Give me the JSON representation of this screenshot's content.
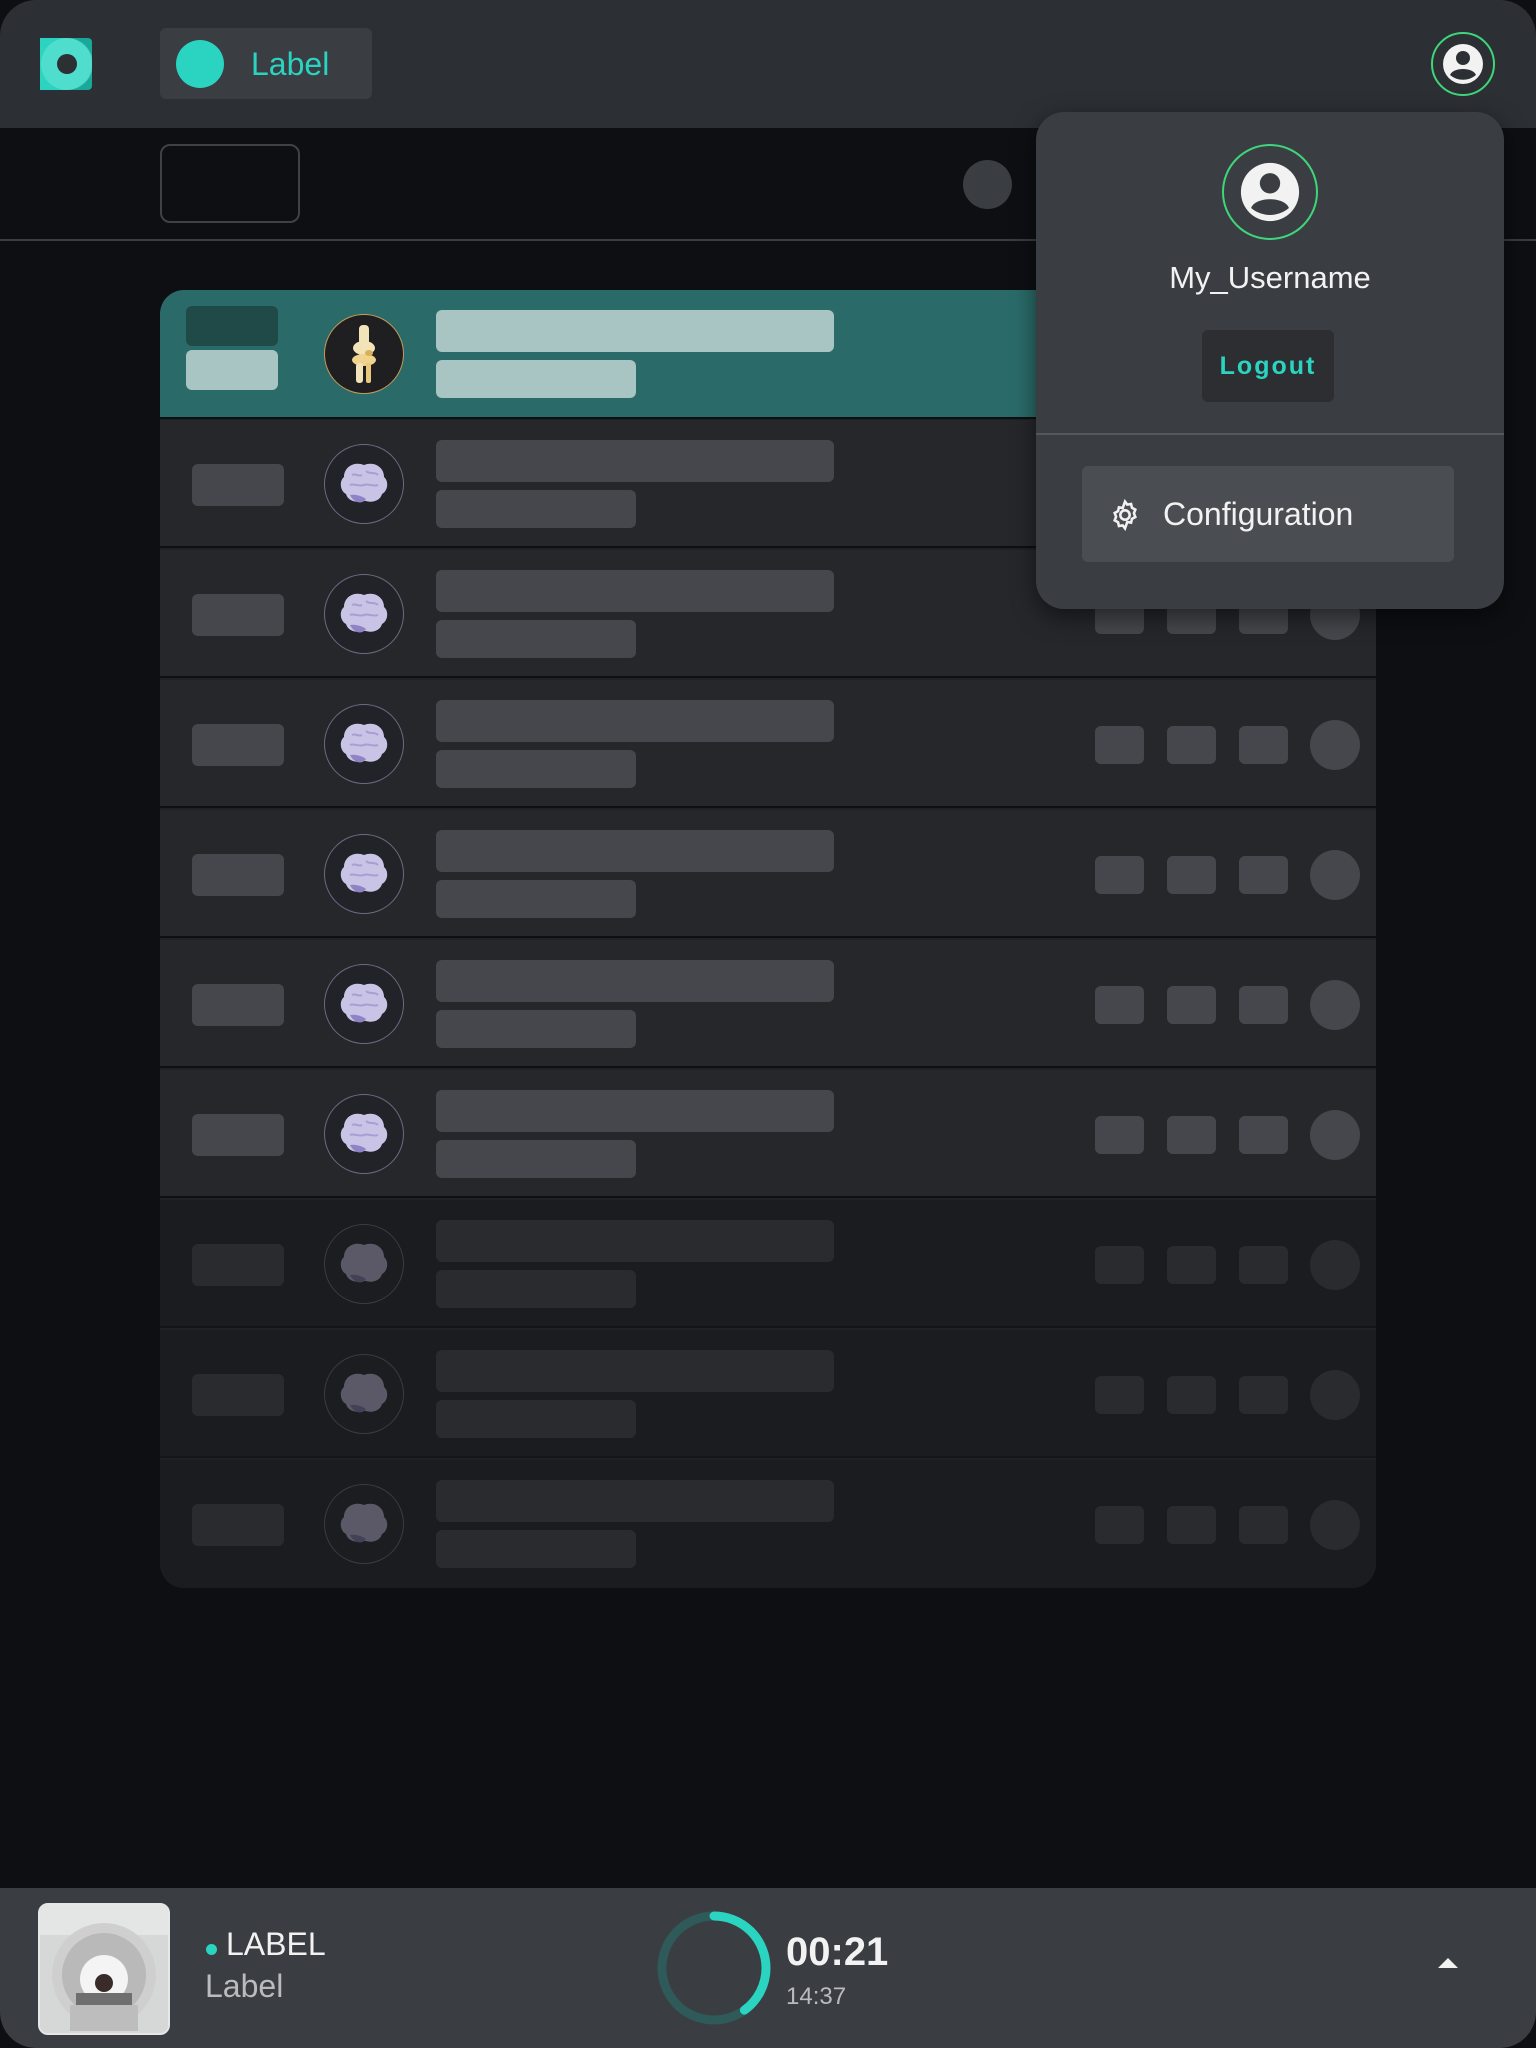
{
  "header": {
    "chip_label": "Label",
    "accent_color": "#2ad4c1",
    "user_ring_color": "#3ed67a",
    "icons": [
      "app-logo",
      "user-circle-icon"
    ]
  },
  "user_menu": {
    "username": "My_Username",
    "logout_label": "Logout",
    "config_label": "Configuration",
    "icons": [
      "user-circle-icon",
      "gear-icon"
    ]
  },
  "list": {
    "rows": [
      {
        "state": "selected",
        "icon": "knee-joint-icon"
      },
      {
        "state": "normal",
        "icon": "brain-icon"
      },
      {
        "state": "normal",
        "icon": "brain-icon"
      },
      {
        "state": "normal",
        "icon": "brain-icon"
      },
      {
        "state": "normal",
        "icon": "brain-icon"
      },
      {
        "state": "normal",
        "icon": "brain-icon"
      },
      {
        "state": "normal",
        "icon": "brain-icon"
      },
      {
        "state": "dim",
        "icon": "brain-icon"
      },
      {
        "state": "dim",
        "icon": "brain-icon"
      },
      {
        "state": "dim",
        "icon": "brain-icon"
      }
    ]
  },
  "player": {
    "title": "LABEL",
    "subtitle": "Label",
    "elapsed": "00:21",
    "total": "14:37",
    "progress_fraction": 0.4,
    "thumbnail_icon": "mri-scanner-image",
    "expand_icon": "caret-up-icon"
  }
}
